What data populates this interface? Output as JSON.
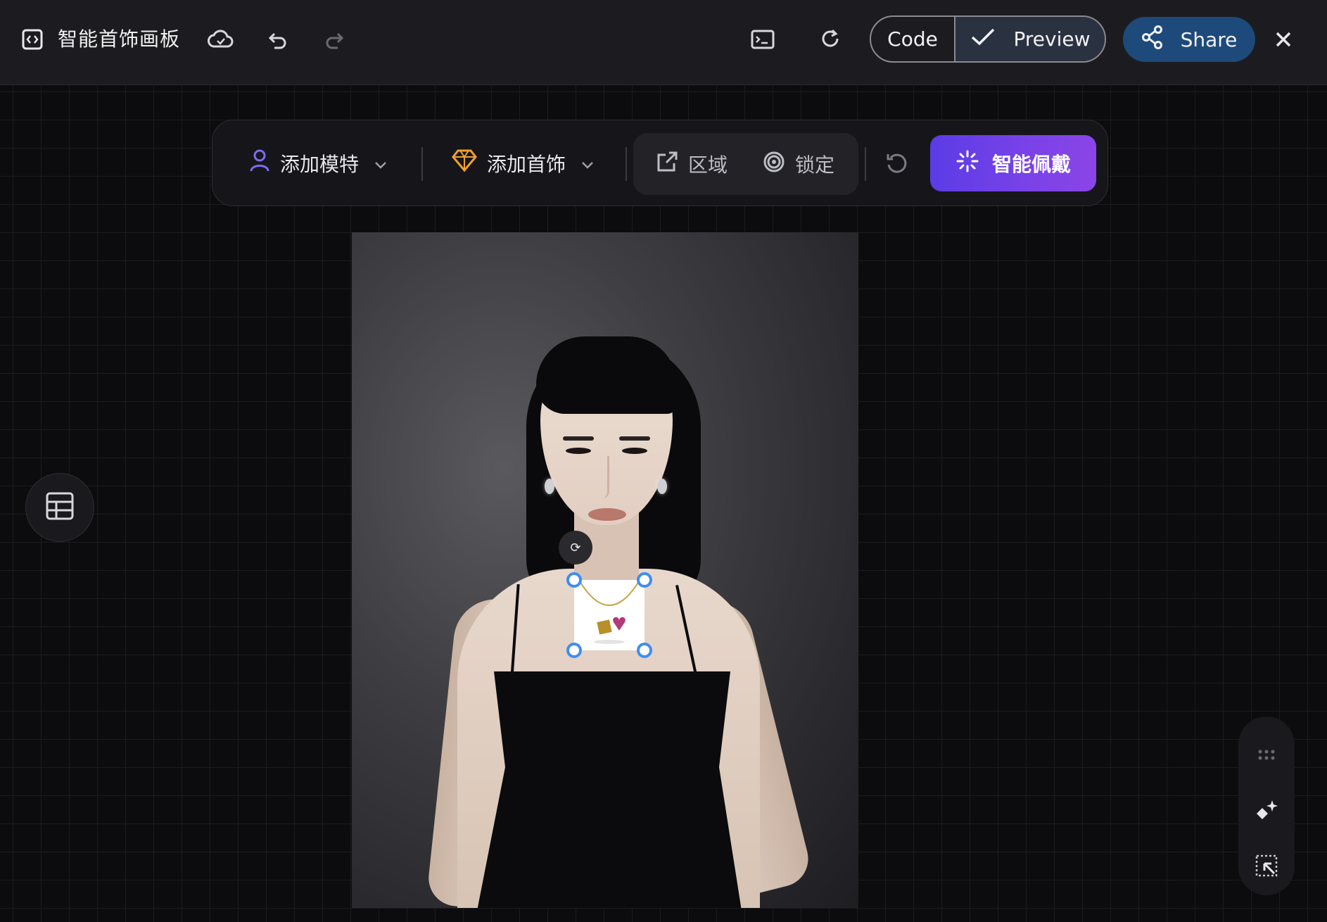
{
  "header": {
    "app_icon": "code-window-icon",
    "title": "智能首饰画板",
    "cloud_icon": "cloud-save-icon",
    "undo_icon": "undo-icon",
    "redo_icon": "redo-icon",
    "terminal_icon": "terminal-icon",
    "refresh_icon": "refresh-icon",
    "code_label": "Code",
    "preview_label": "Preview",
    "share_label": "Share",
    "close_icon": "close-icon"
  },
  "toolbar": {
    "add_model_label": "添加模特",
    "add_jewelry_label": "添加首饰",
    "region_label": "区域",
    "anchor_label": "锁定",
    "reset_icon": "reset-icon",
    "ai_wear_label": "智能佩戴"
  },
  "canvas": {
    "rotate_glyph": "⟳",
    "selection": "necklace-pendant"
  },
  "side": {
    "table_icon": "table-icon"
  },
  "dock": {
    "grip_icon": "drag-grip-icon",
    "magic_icon": "magic-wand-icon",
    "select_icon": "select-arrow-icon"
  },
  "colors": {
    "accent_purple": "#6a3fe8",
    "share_blue": "#1d4a7a",
    "handle_blue": "#3f8ef0",
    "jewelry_gold": "#f0a030"
  }
}
